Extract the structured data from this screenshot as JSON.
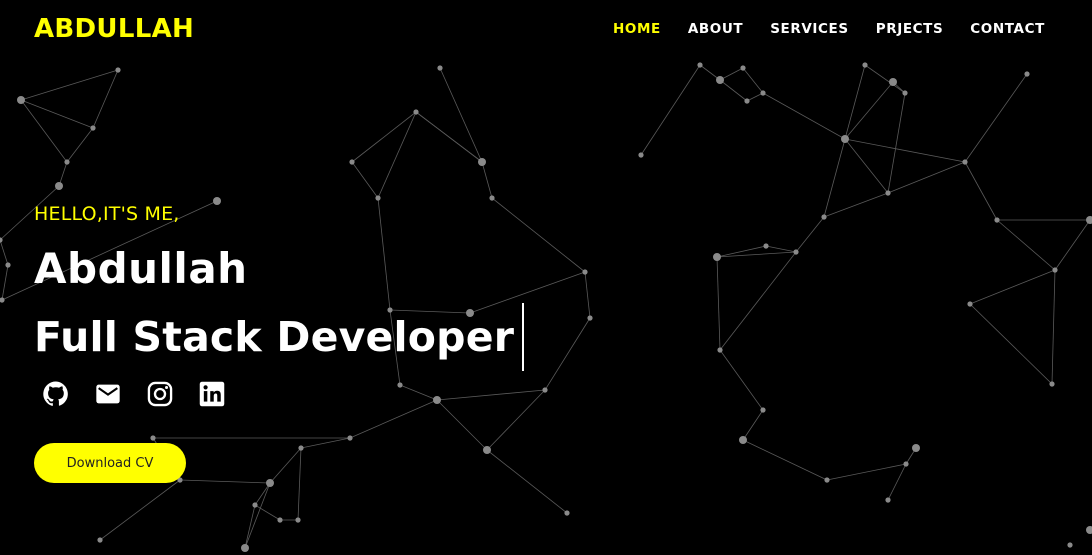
{
  "brand": {
    "logo_text": "ABDULLAH",
    "accent_color": "#ffff00",
    "background_color": "#000000"
  },
  "nav": {
    "items": [
      {
        "label": "HOME",
        "active": true
      },
      {
        "label": "ABOUT",
        "active": false
      },
      {
        "label": "SERVICES",
        "active": false
      },
      {
        "label": "PRJECTS",
        "active": false
      },
      {
        "label": "CONTACT",
        "active": false
      }
    ]
  },
  "hero": {
    "greeting": "HELLO,IT'S ME,",
    "name": "Abdullah",
    "role": "Full Stack Developer",
    "socials": [
      {
        "icon": "github-icon"
      },
      {
        "icon": "mail-icon"
      },
      {
        "icon": "instagram-icon"
      },
      {
        "icon": "linkedin-icon"
      }
    ],
    "cv_button_label": "Download CV"
  }
}
